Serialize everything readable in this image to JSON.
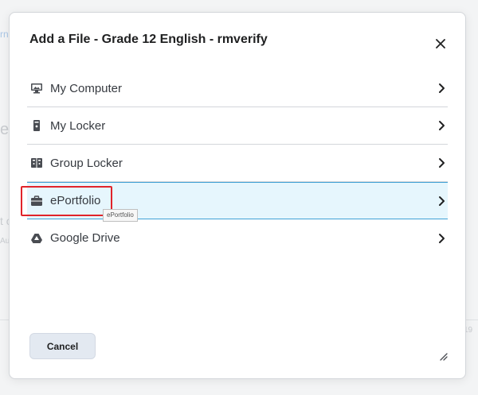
{
  "background": {
    "fragments": [
      "rn",
      "er",
      "t c",
      "Au",
      "19"
    ]
  },
  "dialog": {
    "title": "Add a File - Grade 12 English - rmverify",
    "close_icon": "close-icon",
    "items": [
      {
        "label": "My Computer",
        "icon": "computer-icon"
      },
      {
        "label": "My Locker",
        "icon": "locker-icon"
      },
      {
        "label": "Group Locker",
        "icon": "group-locker-icon"
      },
      {
        "label": "ePortfolio",
        "icon": "briefcase-icon",
        "selected": true,
        "tooltip": "ePortfolio"
      },
      {
        "label": "Google Drive",
        "icon": "google-drive-icon"
      }
    ],
    "cancel_label": "Cancel"
  },
  "colors": {
    "selected_bg": "#e6f6fd",
    "selected_border": "#3fa0d6",
    "highlight": "#e0242a",
    "button_bg": "#e3e9f1"
  }
}
